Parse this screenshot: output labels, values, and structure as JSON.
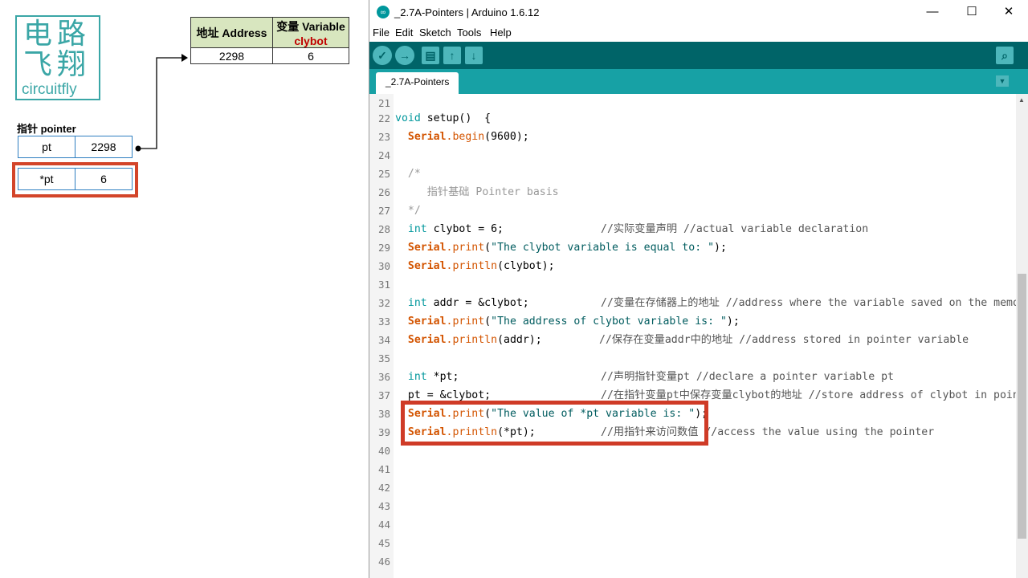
{
  "logo": {
    "line1": "电路",
    "line2": "飞翔",
    "text": "circuitfly"
  },
  "address_table": {
    "header_address": "地址 Address",
    "header_variable": "变量 Variable",
    "header_variable_name": "clybot",
    "address_value": "2298",
    "variable_value": "6"
  },
  "pointer_box": {
    "title": "指针 pointer",
    "row1": {
      "name": "pt",
      "value": "2298"
    },
    "row2": {
      "name": "*pt",
      "value": "6"
    }
  },
  "window": {
    "title": "_2.7A-Pointers | Arduino 1.6.12",
    "minimize": "—",
    "maximize": "☐",
    "close": "✕"
  },
  "menu": [
    "File",
    "Edit",
    "Sketch",
    "Tools",
    "Help"
  ],
  "toolbar": {
    "verify": "✓",
    "upload": "→",
    "new": "▤",
    "open": "↑",
    "save": "↓",
    "serial_monitor": "⌕"
  },
  "tab": {
    "label": "_2.7A-Pointers",
    "menu_icon": "▼"
  },
  "editor": {
    "lines": [
      {
        "n": "21"
      },
      {
        "n": "22"
      },
      {
        "n": "23"
      },
      {
        "n": "24"
      },
      {
        "n": "25",
        "text": "  /*"
      },
      {
        "n": "26",
        "text": "     指针基础 Pointer basis"
      },
      {
        "n": "27",
        "text": "  */"
      },
      {
        "n": "28"
      },
      {
        "n": "29"
      },
      {
        "n": "30"
      },
      {
        "n": "31"
      },
      {
        "n": "32"
      },
      {
        "n": "33"
      },
      {
        "n": "34"
      },
      {
        "n": "35"
      },
      {
        "n": "36"
      },
      {
        "n": "37"
      },
      {
        "n": "38"
      },
      {
        "n": "39"
      },
      {
        "n": "40"
      },
      {
        "n": "41"
      },
      {
        "n": "42"
      },
      {
        "n": "43"
      },
      {
        "n": "44"
      },
      {
        "n": "45"
      },
      {
        "n": "46"
      }
    ],
    "tokens": {
      "void": "void",
      "setup": " setup()  {",
      "int": "int",
      "serial": "Serial",
      "begin": ".begin",
      "print": ".print",
      "println": ".println",
      "l23_args": "(9600);",
      "l28_code": " clybot = 6;",
      "l28_cmt": "//实际变量声明 //actual variable declaration",
      "l29_open": "(",
      "l29_str": "\"The clybot variable is equal to: \"",
      "l29_close": ");",
      "l30_args": "(clybot);",
      "l32_code": " addr = &clybot;",
      "l32_cmt": "//变量在存储器上的地址 //address where the variable saved on the memory",
      "l33_str": "\"The address of clybot variable is: \"",
      "l34_args": "(addr);",
      "l34_cmt": "//保存在变量addr中的地址 //address stored in pointer variable",
      "l36_code": " *pt;",
      "l36_cmt": "//声明指针变量pt //declare a pointer variable pt",
      "l37_code": "pt = &clybot;",
      "l37_cmt": "//在指针变量pt中保存变量clybot的地址 //store address of clybot in pointer variable",
      "l38_str": "\"The value of *pt variable is: \"",
      "l39_args": "(*pt);",
      "l39_cmt": "//用指针来访问数值 //access the value using the pointer"
    }
  },
  "colors": {
    "toolbar": "#006468",
    "tabbar": "#17a1a5",
    "keyword": "#00979c",
    "object": "#d35400",
    "highlight": "#cf3b27",
    "logo": "#3aa6a6"
  }
}
